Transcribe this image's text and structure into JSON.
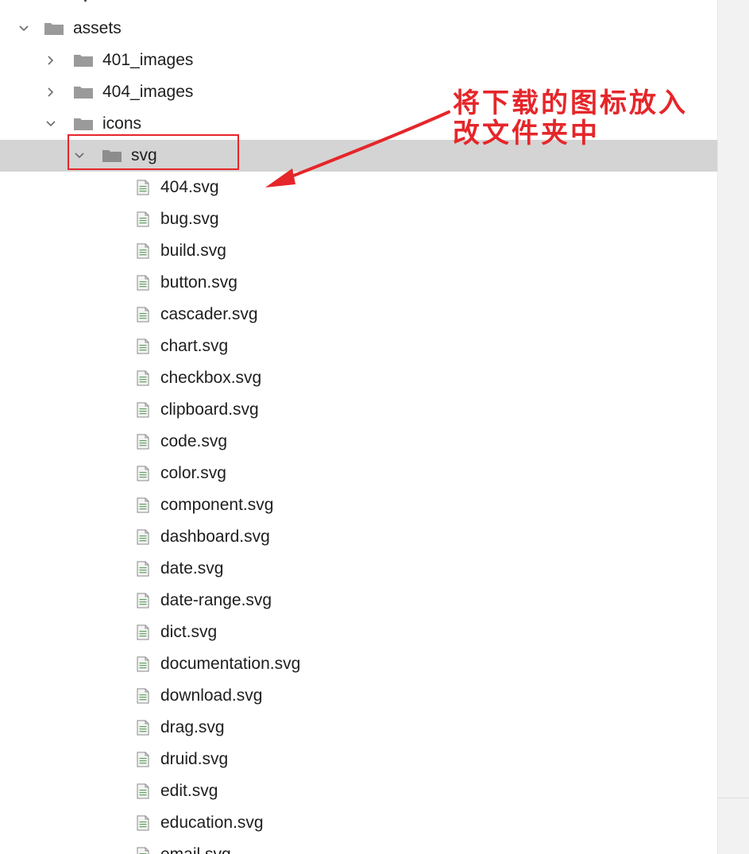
{
  "tree": {
    "assets": {
      "label": "assets",
      "expanded": true
    },
    "children": [
      {
        "label": "401_images",
        "expanded": false
      },
      {
        "label": "404_images",
        "expanded": false
      },
      {
        "label": "icons",
        "expanded": true
      }
    ],
    "svg_folder": {
      "label": "svg",
      "expanded": true,
      "selected": true
    },
    "files": [
      "404.svg",
      "bug.svg",
      "build.svg",
      "button.svg",
      "cascader.svg",
      "chart.svg",
      "checkbox.svg",
      "clipboard.svg",
      "code.svg",
      "color.svg",
      "component.svg",
      "dashboard.svg",
      "date.svg",
      "date-range.svg",
      "dict.svg",
      "documentation.svg",
      "download.svg",
      "drag.svg",
      "druid.svg",
      "edit.svg",
      "education.svg",
      "email.svg"
    ]
  },
  "annotation": {
    "line1": "将下载的图标放入",
    "line2": "改文件夹中",
    "color": "#e5262a"
  },
  "icons": {
    "folder": "folder-icon",
    "file": "svg-file-icon",
    "expand": "chevron-down-icon",
    "collapse": "chevron-right-icon"
  }
}
